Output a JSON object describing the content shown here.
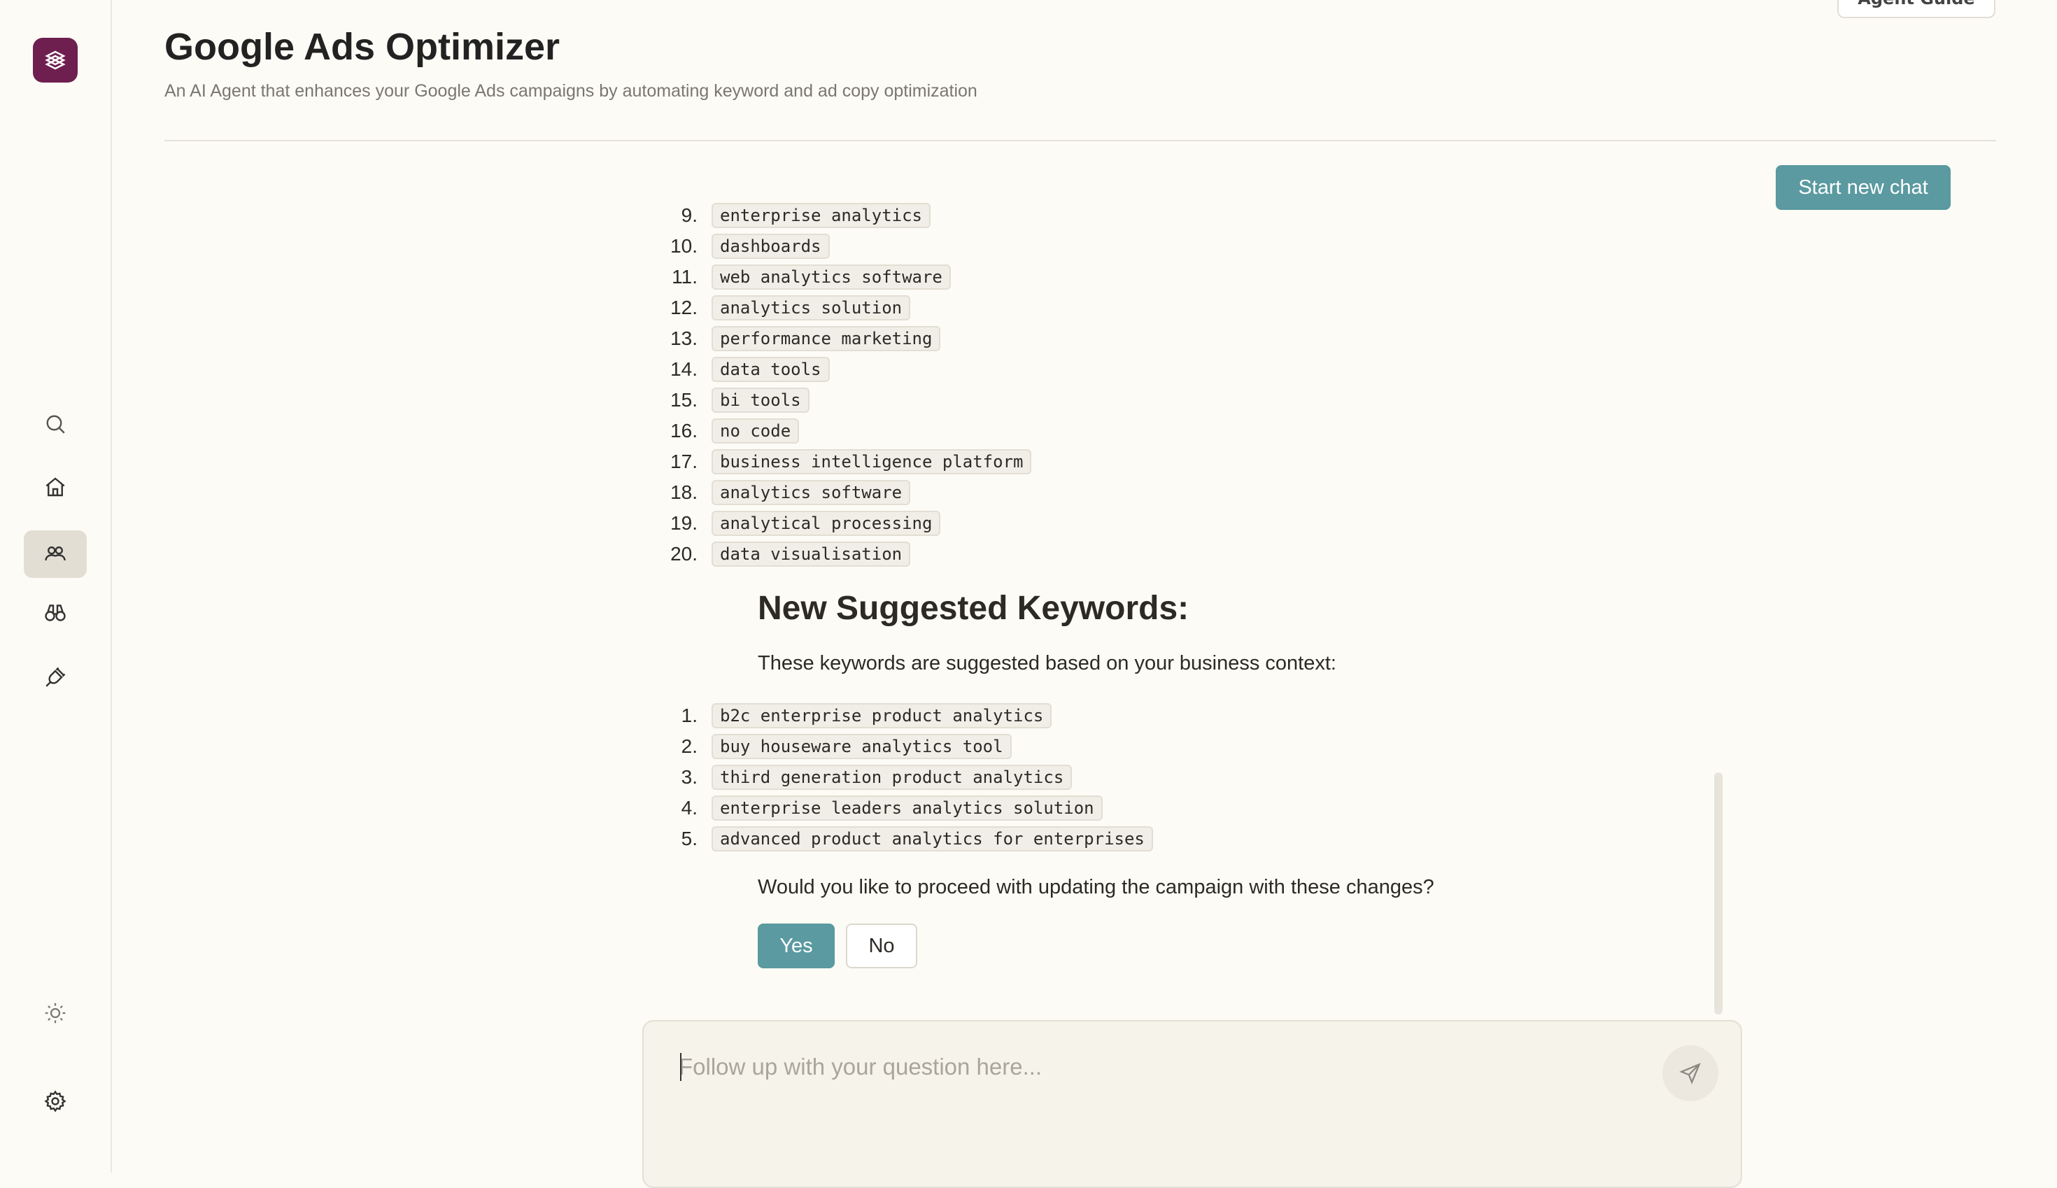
{
  "app": {
    "title": "Google Ads Optimizer",
    "subtitle": "An AI Agent that enhances your Google Ads campaigns by automating keyword and ad copy optimization",
    "guide_label": "Agent Guide",
    "new_chat_label": "Start new chat"
  },
  "sidebar": {
    "icons": [
      "app-logo-icon",
      "search-icon",
      "home-icon",
      "agents-icon",
      "binoculars-icon",
      "integrations-icon",
      "theme-sun-icon",
      "settings-gear-icon"
    ],
    "active": "agents-icon"
  },
  "message": {
    "existing_keywords": [
      {
        "num": "9.",
        "text": "enterprise analytics"
      },
      {
        "num": "10.",
        "text": "dashboards"
      },
      {
        "num": "11.",
        "text": "web analytics software"
      },
      {
        "num": "12.",
        "text": "analytics solution"
      },
      {
        "num": "13.",
        "text": "performance marketing"
      },
      {
        "num": "14.",
        "text": "data tools"
      },
      {
        "num": "15.",
        "text": "bi tools"
      },
      {
        "num": "16.",
        "text": "no code"
      },
      {
        "num": "17.",
        "text": "business intelligence platform"
      },
      {
        "num": "18.",
        "text": "analytics software"
      },
      {
        "num": "19.",
        "text": "analytical processing"
      },
      {
        "num": "20.",
        "text": "data visualisation"
      }
    ],
    "heading": "New Suggested Keywords:",
    "intro": "These keywords are suggested based on your business context:",
    "suggested_keywords": [
      {
        "num": "1.",
        "text": "b2c enterprise product analytics"
      },
      {
        "num": "2.",
        "text": "buy houseware analytics tool"
      },
      {
        "num": "3.",
        "text": "third generation product analytics"
      },
      {
        "num": "4.",
        "text": "enterprise leaders analytics solution"
      },
      {
        "num": "5.",
        "text": "advanced product analytics for enterprises"
      }
    ],
    "question": "Would you like to proceed with updating the campaign with these changes?",
    "yes_label": "Yes",
    "no_label": "No"
  },
  "composer": {
    "placeholder": "Follow up with your question here...",
    "value": ""
  },
  "colors": {
    "accent": "#5a9aa0",
    "logo_bg": "#6e1f4f",
    "background": "#fdfbf5"
  }
}
